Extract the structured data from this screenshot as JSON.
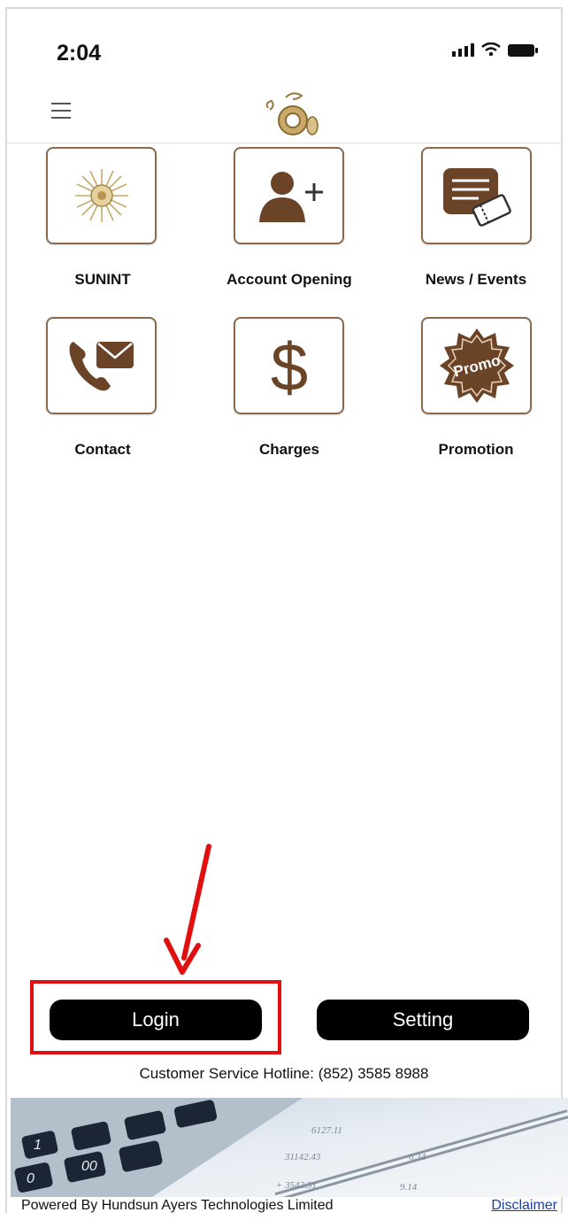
{
  "status_bar": {
    "time": "2:04"
  },
  "header": {
    "menu_icon": "hamburger-menu-icon",
    "logo_icon": "dragon-coin-logo"
  },
  "menu": {
    "items": [
      {
        "label": "SUNINT",
        "icon": "sun-emblem-icon"
      },
      {
        "label": "Account Opening",
        "icon": "add-user-icon"
      },
      {
        "label": "News / Events",
        "icon": "news-ticket-icon"
      },
      {
        "label": "Contact",
        "icon": "phone-mail-icon"
      },
      {
        "label": "Charges",
        "icon": "dollar-icon"
      },
      {
        "label": "Promotion",
        "icon": "promo-badge-icon",
        "badge_text": "Promo"
      }
    ]
  },
  "actions": {
    "login_label": "Login",
    "setting_label": "Setting"
  },
  "footer": {
    "hotline": "Customer Service Hotline: (852) 3585 8988",
    "powered_by": "Powered By Hundsun Ayers Technologies Limited",
    "disclaimer": "Disclaimer"
  },
  "colors": {
    "accent": "#6b4428",
    "tile_border": "#8a6a4f",
    "button_bg": "#000000",
    "highlight": "#e01010",
    "link": "#1a3fa0"
  }
}
